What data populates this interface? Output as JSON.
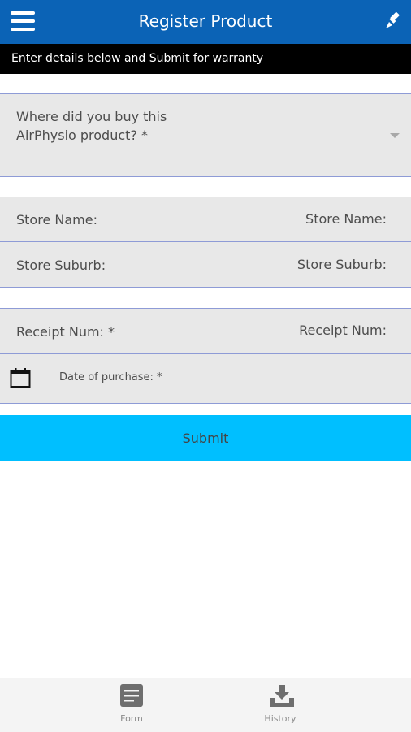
{
  "header": {
    "title": "Register Product",
    "menu_icon": "hamburger-menu-icon",
    "action_icon": "paint-brush-icon",
    "bg_color": "#0b63b6"
  },
  "banner": {
    "text": "Enter details below and Submit for warranty"
  },
  "form": {
    "store_select": {
      "label": "Where did you buy this AirPhysio product? *"
    },
    "store_name": {
      "label": "Store Name:",
      "placeholder": "Store Name:"
    },
    "store_suburb": {
      "label": "Store Suburb:",
      "placeholder": "Store Suburb:"
    },
    "receipt": {
      "label": "Receipt Num: *",
      "placeholder": "Receipt Num:"
    },
    "date": {
      "label": "Date of purchase: *"
    },
    "submit_label": "Submit",
    "submit_color": "#00bfff"
  },
  "bottom_nav": {
    "items": [
      {
        "label": "Form",
        "icon": "document-icon"
      },
      {
        "label": "History",
        "icon": "download-tray-icon"
      }
    ]
  }
}
